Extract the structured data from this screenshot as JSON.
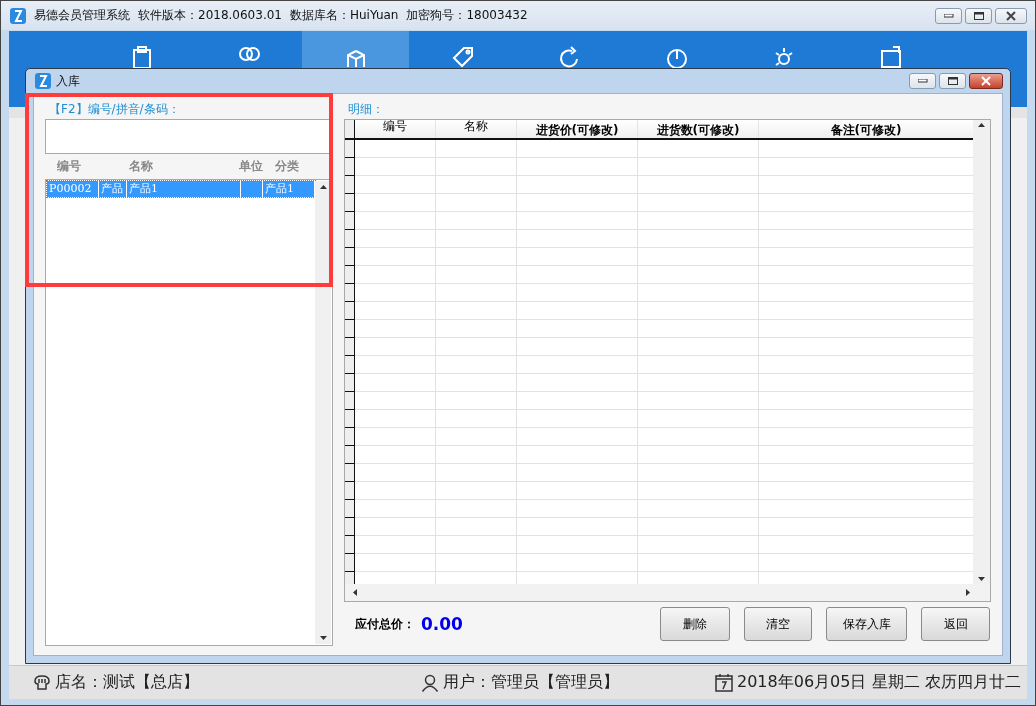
{
  "app_window": {
    "title": "易德会员管理系统",
    "version": "软件版本：2018.0603.01",
    "database": "数据库名：HuiYuan",
    "dongle": "加密狗号：18003432"
  },
  "toolbar_items": [
    {
      "kind": "clipboard",
      "selected": false
    },
    {
      "kind": "people",
      "selected": false
    },
    {
      "kind": "box",
      "selected": true
    },
    {
      "kind": "tag",
      "selected": false
    },
    {
      "kind": "refresh",
      "selected": false
    },
    {
      "kind": "chart",
      "selected": false
    },
    {
      "kind": "gear",
      "selected": false
    },
    {
      "kind": "card",
      "selected": false
    }
  ],
  "dialog": {
    "title": "入库",
    "search": {
      "label": "【F2】编号/拼音/条码："
    },
    "product_list": {
      "columns": [
        "编号",
        "名称",
        "单位",
        "分类"
      ],
      "rows": [
        {
          "code": "P00002",
          "column_2": "产品",
          "name": "产品1",
          "category": "产品1",
          "selected": true
        }
      ]
    },
    "detail": {
      "label": "明细：",
      "columns": [
        "编号",
        "名称",
        "进货价(可修改)",
        "进货数(可修改)",
        "备注(可修改)"
      ]
    },
    "total": {
      "label": "应付总价：",
      "value": "0.00"
    },
    "buttons": [
      "删除",
      "清空",
      "保存入库",
      "返回"
    ]
  },
  "status_bar": {
    "shop": "店名：测试【总店】",
    "user": "用户：管理员【管理员】",
    "date": "2018年06月05日 星期二 农历四月廿二"
  }
}
